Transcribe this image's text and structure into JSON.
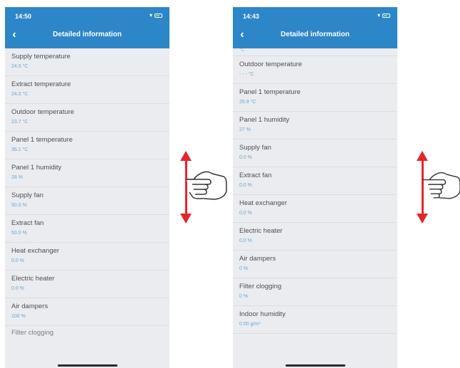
{
  "colors": {
    "header": "#2d86c8",
    "list_background": "#ebecef",
    "value_text": "#66a6d8",
    "label_text": "#4c4f55",
    "arrow": "#e3262a"
  },
  "left_screen": {
    "status_time": "14:50",
    "title": "Detailed information",
    "back_icon": "chevron-left-icon",
    "rows": [
      {
        "label": "Supply temperature",
        "value": "24.0 °C"
      },
      {
        "label": "Extract temperature",
        "value": "24.0 °C"
      },
      {
        "label": "Outdoor temperature",
        "value": "23.7 °C"
      },
      {
        "label": "Panel 1 temperature",
        "value": "36.1 °C"
      },
      {
        "label": "Panel 1 humidity",
        "value": "28 %"
      },
      {
        "label": "Supply fan",
        "value": "50.0 %"
      },
      {
        "label": "Extract fan",
        "value": "50.0 %"
      },
      {
        "label": "Heat exchanger",
        "value": "0.0 %"
      },
      {
        "label": "Electric heater",
        "value": "0.0 %"
      },
      {
        "label": "Air dampers",
        "value": "100 %"
      }
    ],
    "partial_row": "Filter clogging"
  },
  "right_screen": {
    "status_time": "14:43",
    "title": "Detailed information",
    "back_icon": "chevron-left-icon",
    "top_partial_value": "°C",
    "rows": [
      {
        "label": "Outdoor temperature",
        "value": "- - - °C"
      },
      {
        "label": "Panel 1 temperature",
        "value": "25.9 °C"
      },
      {
        "label": "Panel 1 humidity",
        "value": "27 %"
      },
      {
        "label": "Supply fan",
        "value": "0.0 %"
      },
      {
        "label": "Extract fan",
        "value": "0.0 %"
      },
      {
        "label": "Heat exchanger",
        "value": "0.0 %"
      },
      {
        "label": "Electric heater",
        "value": "0.0 %"
      },
      {
        "label": "Air dampers",
        "value": "0 %"
      },
      {
        "label": "Filter clogging",
        "value": "0 %"
      },
      {
        "label": "Indoor humidity",
        "value": "0.00 g/m³"
      }
    ]
  },
  "gesture": {
    "icon": "swipe-hand-icon",
    "arrow": "up-down-arrow-icon"
  }
}
